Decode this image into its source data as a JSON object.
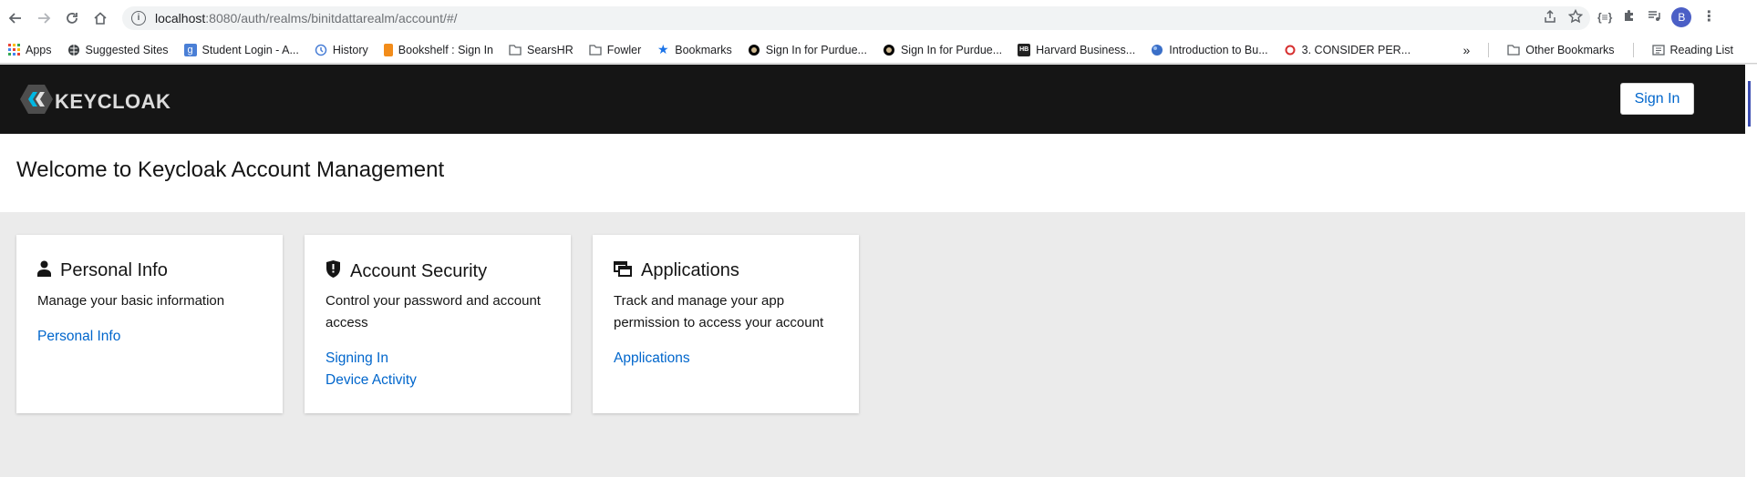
{
  "browser": {
    "url_host": "localhost",
    "url_rest": ":8080/auth/realms/binitdattarealm/account/#/",
    "avatar_letter": "B"
  },
  "bookmarks": [
    {
      "label": "Apps",
      "icon": "apps-grid-icon"
    },
    {
      "label": "Suggested Sites",
      "icon": "globe-icon"
    },
    {
      "label": "Student Login - A...",
      "icon": "student-login-icon"
    },
    {
      "label": "History",
      "icon": "history-icon"
    },
    {
      "label": "Bookshelf : Sign In",
      "icon": "bookshelf-icon"
    },
    {
      "label": "SearsHR",
      "icon": "folder-icon"
    },
    {
      "label": "Fowler",
      "icon": "folder-icon"
    },
    {
      "label": "Bookmarks",
      "icon": "star-icon"
    },
    {
      "label": "Sign In for Purdue...",
      "icon": "purdue-icon"
    },
    {
      "label": "Sign In for Purdue...",
      "icon": "purdue-icon"
    },
    {
      "label": "Harvard Business...",
      "icon": "harvard-icon"
    },
    {
      "label": "Introduction to Bu...",
      "icon": "globe-icon"
    },
    {
      "label": "3. CONSIDER PER...",
      "icon": "consider-icon"
    }
  ],
  "bookmarks_overflow": "»",
  "other_bookmarks": "Other Bookmarks",
  "reading_list": "Reading List",
  "header": {
    "logo_text": "KEYCLOAK",
    "signin_label": "Sign In"
  },
  "welcome_title": "Welcome to Keycloak Account Management",
  "cards": [
    {
      "title": "Personal Info",
      "description": "Manage your basic information",
      "icon": "user-icon",
      "links": [
        "Personal Info"
      ]
    },
    {
      "title": "Account Security",
      "description": "Control your password and account access",
      "icon": "shield-icon",
      "links": [
        "Signing In",
        "Device Activity"
      ]
    },
    {
      "title": "Applications",
      "description": "Track and manage your app permission to access your account",
      "icon": "windows-icon",
      "links": [
        "Applications"
      ]
    }
  ],
  "colors": {
    "header_bg": "#151515",
    "link": "#0066cc",
    "page_bg": "#ebebeb"
  }
}
